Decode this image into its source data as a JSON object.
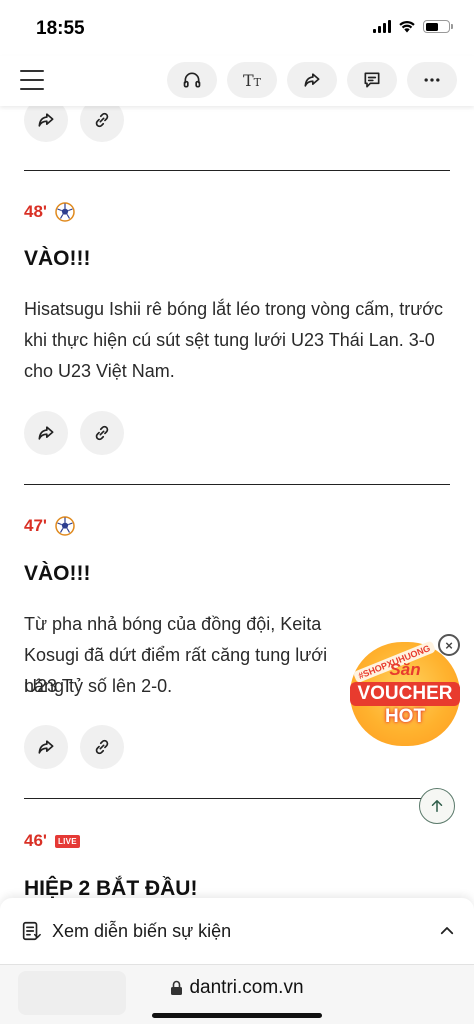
{
  "status_bar": {
    "time": "18:55"
  },
  "toolbar": {
    "icons": [
      "headphones-icon",
      "text-size-icon",
      "share-icon",
      "comment-icon",
      "more-icon"
    ],
    "text_size_glyph": "T",
    "text_size_glyph_small": "T"
  },
  "events": [
    {
      "minute": "48'",
      "icon": "soccer-ball-icon",
      "headline": "VÀO!!!",
      "body": "Hisatsugu Ishii rê bóng lắt léo trong vòng cấm, trước khi thực hiện cú sút sệt tung lưới U23 Thái Lan. 3-0 cho U23 Việt Nam."
    },
    {
      "minute": "47'",
      "icon": "soccer-ball-icon",
      "headline": "VÀO!!!",
      "body": "Từ pha nhả bóng của đồng đội, Keita Kosugi đã dứt điểm rất căng tung lưới U23 T"
    },
    {
      "minute": "46'",
      "icon": "live-badge",
      "live_label": "LIVE",
      "headline": "HIỆP 2 BẮT ĐẦU!"
    }
  ],
  "event2_line3": "nâng tỷ số lên 2-0.",
  "promo": {
    "tag": "#SHOPXUHUONG",
    "line1": "Săn",
    "line2": "VOUCHER",
    "line3": "HOT",
    "close": "×"
  },
  "events_bar": {
    "label": "Xem diễn biến sự kiện"
  },
  "browser": {
    "url": "dantri.com.vn"
  },
  "colors": {
    "minute_red": "#d93025",
    "live_red": "#e53935",
    "promo_orange": "#ffb22e"
  }
}
